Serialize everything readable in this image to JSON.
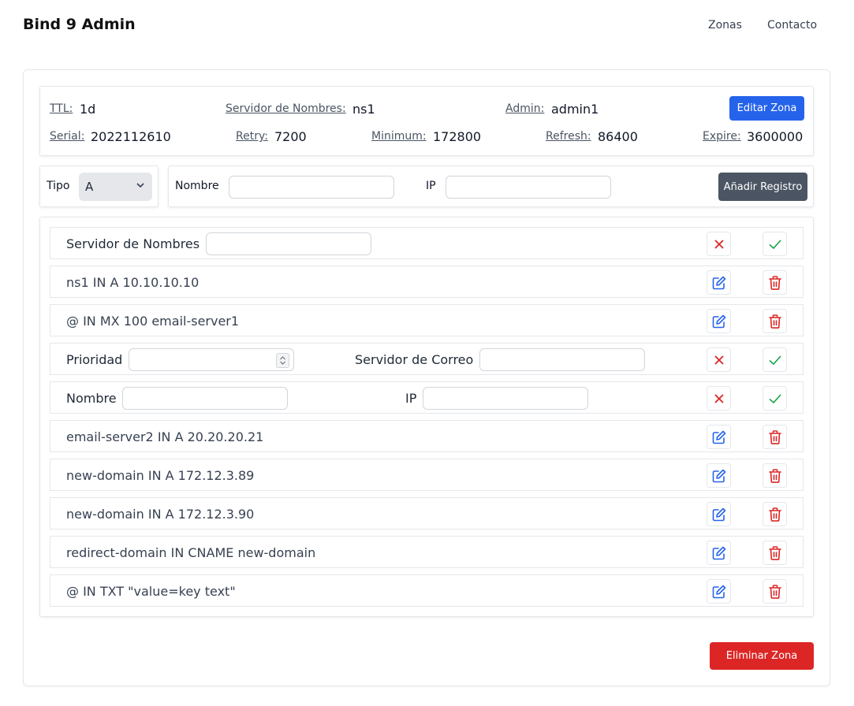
{
  "header": {
    "title": "Bind 9 Admin",
    "nav": [
      "Zonas",
      "Contacto"
    ]
  },
  "soa": {
    "ttl_label": "TTL:",
    "ttl": "1d",
    "ns_label": "Servidor de Nombres:",
    "ns": "ns1",
    "admin_label": "Admin:",
    "admin": "admin1",
    "edit_button": "Editar Zona",
    "serial_label": "Serial:",
    "serial": "2022112610",
    "retry_label": "Retry:",
    "retry": "7200",
    "minimum_label": "Minimum:",
    "minimum": "172800",
    "refresh_label": "Refresh:",
    "refresh": "86400",
    "expire_label": "Expire:",
    "expire": "3600000"
  },
  "add_record": {
    "type_label": "Tipo",
    "type_value": "A",
    "name_label": "Nombre",
    "name_value": "",
    "ip_label": "IP",
    "ip_value": "",
    "add_button": "Añadir Registro"
  },
  "records": [
    {
      "kind": "edit-ns",
      "label": "Servidor de Nombres",
      "value": ""
    },
    {
      "kind": "record",
      "text": "ns1 IN A 10.10.10.10"
    },
    {
      "kind": "record",
      "text": "@ IN MX 100 email-server1"
    },
    {
      "kind": "edit-mx",
      "priority_label": "Prioridad",
      "priority_value": "",
      "mail_label": "Servidor de Correo",
      "mail_value": ""
    },
    {
      "kind": "edit-a",
      "name_label": "Nombre",
      "name_value": "",
      "ip_label": "IP",
      "ip_value": ""
    },
    {
      "kind": "record",
      "text": "email-server2 IN A 20.20.20.21"
    },
    {
      "kind": "record",
      "text": "new-domain IN A 172.12.3.89"
    },
    {
      "kind": "record",
      "text": "new-domain IN A 172.12.3.90"
    },
    {
      "kind": "record",
      "text": "redirect-domain IN CNAME new-domain"
    },
    {
      "kind": "record",
      "text": "@ IN TXT \"value=key text\""
    }
  ],
  "delete_zone_button": "Eliminar Zona",
  "icons": {
    "cancel": "x-icon",
    "confirm": "check-icon",
    "edit": "pencil-square-icon",
    "delete": "trash-icon"
  },
  "colors": {
    "primary": "#2563eb",
    "danger": "#dc2626",
    "success": "#16a34a",
    "dark": "#4b5563"
  }
}
